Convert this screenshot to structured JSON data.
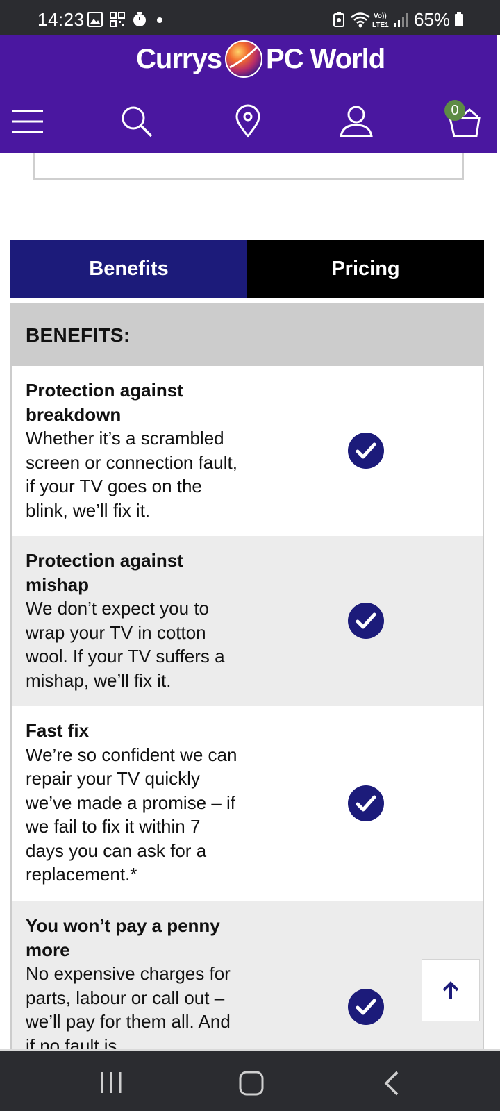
{
  "status_bar": {
    "time": "14:23",
    "battery": "65%",
    "icons": [
      "gallery-icon",
      "qr-icon",
      "timer-icon",
      "dot-icon",
      "battery-saver-icon",
      "wifi-icon",
      "volte-icon",
      "signal-icon",
      "battery-icon"
    ]
  },
  "header": {
    "logo_left": "Currys",
    "logo_right": "PC World",
    "cart_count": "0",
    "colors": {
      "header_bg": "#4a17a0",
      "badge": "#5d8b45"
    },
    "icons": [
      "menu-icon",
      "search-icon",
      "location-icon",
      "account-icon",
      "basket-icon"
    ]
  },
  "tabs": {
    "benefits": "Benefits",
    "pricing": "Pricing",
    "colors": {
      "active": "#1c1b7a",
      "inactive": "#000000"
    }
  },
  "benefits": {
    "header": "BENEFITS:",
    "rows": [
      {
        "title": "Protection against breakdown",
        "desc": "Whether it’s a scrambled screen or connection fault, if your TV goes on the blink, we’ll fix it."
      },
      {
        "title": "Protection against mishap",
        "desc": "We don’t expect you to wrap your TV in cotton wool. If your TV suffers a mishap, we’ll fix it."
      },
      {
        "title": "Fast fix",
        "desc": "We’re so confident we can repair your TV quickly we’ve made a promise – if we fail to fix it within 7 days you can ask for a replacement.*"
      },
      {
        "title": "You won’t pay a penny more",
        "desc": "No expensive charges for parts, labour or call out – we’ll pay for them all. And if no fault is"
      }
    ]
  },
  "back_to_top": {
    "icon": "arrow-up-icon"
  },
  "bottom_nav": {
    "icons": [
      "recent-apps-icon",
      "home-icon",
      "back-icon"
    ]
  }
}
